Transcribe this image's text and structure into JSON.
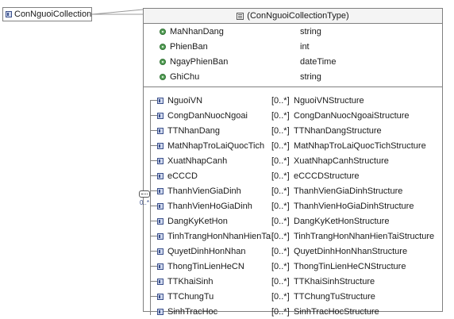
{
  "root_element": {
    "label": "ConNguoiCollection"
  },
  "complex_type": {
    "label": "(ConNguoiCollectionType)"
  },
  "attributes": [
    {
      "name": "MaNhanDang",
      "type": "string"
    },
    {
      "name": "PhienBan",
      "type": "int"
    },
    {
      "name": "NgayPhienBan",
      "type": "dateTime"
    },
    {
      "name": "GhiChu",
      "type": "string"
    }
  ],
  "sequence": {
    "cardinality": "0..*"
  },
  "children": [
    {
      "name": "NguoiVN",
      "cardinality": "[0..*]",
      "type": "NguoiVNStructure"
    },
    {
      "name": "CongDanNuocNgoai",
      "cardinality": "[0..*]",
      "type": "CongDanNuocNgoaiStructure"
    },
    {
      "name": "TTNhanDang",
      "cardinality": "[0..*]",
      "type": "TTNhanDangStructure"
    },
    {
      "name": "MatNhapTroLaiQuocTich",
      "cardinality": "[0..*]",
      "type": "MatNhapTroLaiQuocTichStructure"
    },
    {
      "name": "XuatNhapCanh",
      "cardinality": "[0..*]",
      "type": "XuatNhapCanhStructure"
    },
    {
      "name": "eCCCD",
      "cardinality": "[0..*]",
      "type": "eCCCDStructure"
    },
    {
      "name": "ThanhVienGiaDinh",
      "cardinality": "[0..*]",
      "type": "ThanhVienGiaDinhStructure"
    },
    {
      "name": "ThanhVienHoGiaDinh",
      "cardinality": "[0..*]",
      "type": "ThanhVienHoGiaDinhStructure"
    },
    {
      "name": "DangKyKetHon",
      "cardinality": "[0..*]",
      "type": "DangKyKetHonStructure"
    },
    {
      "name": "TinhTrangHonNhanHienTai",
      "cardinality": "[0..*]",
      "type": "TinhTrangHonNhanHienTaiStructure"
    },
    {
      "name": "QuyetDinhHonNhan",
      "cardinality": "[0..*]",
      "type": "QuyetDinhHonNhanStructure"
    },
    {
      "name": "ThongTinLienHeCN",
      "cardinality": "[0..*]",
      "type": "ThongTinLienHeCNStructure"
    },
    {
      "name": "TTKhaiSinh",
      "cardinality": "[0..*]",
      "type": "TTKhaiSinhStructure"
    },
    {
      "name": "TTChungTu",
      "cardinality": "[0..*]",
      "type": "TTChungTuStructure"
    },
    {
      "name": "SinhTracHoc",
      "cardinality": "[0..*]",
      "type": "SinhTracHocStructure"
    }
  ]
}
